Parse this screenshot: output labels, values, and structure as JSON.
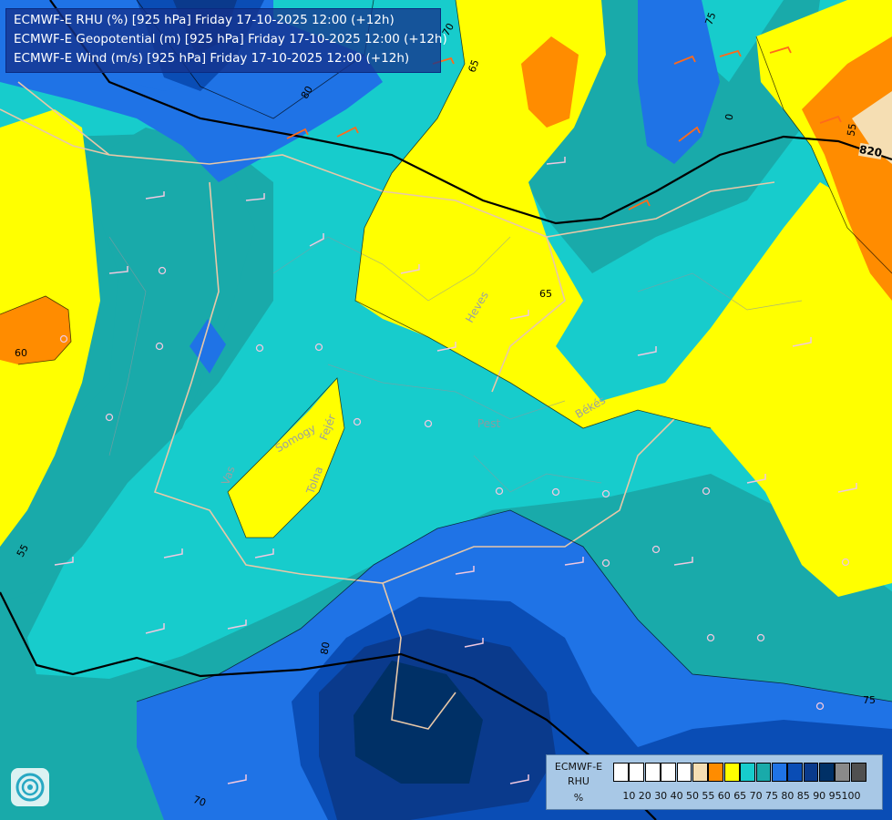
{
  "header": {
    "line1": "ECMWF-E RHU (%) [925 hPa] Friday 17-10-2025 12:00 (+12h)",
    "line2": "ECMWF-E Geopotential (m) [925 hPa] Friday 17-10-2025 12:00 (+12h)",
    "line3": "ECMWF-E Wind (m/s) [925 hPa] Friday 17-10-2025 12:00 (+12h)"
  },
  "legend": {
    "model": "ECMWF-E",
    "param": "RHU",
    "unit": "%",
    "colors": [
      "#ffffff",
      "#ffffff",
      "#ffffff",
      "#ffffff",
      "#ffffff",
      "#f5deb3",
      "#ff8c00",
      "#ffff00",
      "#17cccc",
      "#19aaaa",
      "#1f73e6",
      "#0a4db5",
      "#0a3a8c",
      "#003066",
      "#8a8a8a",
      "#505050"
    ],
    "ticks": [
      "10",
      "20",
      "30",
      "40",
      "50",
      "55",
      "60",
      "65",
      "70",
      "75",
      "80",
      "85",
      "90",
      "95",
      "100"
    ]
  },
  "map": {
    "regions": [
      "Heves",
      "Békés",
      "Pest",
      "Somogy",
      "Fejér",
      "Tolna",
      "Vas"
    ],
    "contour_labels": [
      "70",
      "75",
      "80",
      "65",
      "0",
      "55",
      "820",
      "60",
      "65",
      "55",
      "80",
      "70",
      "75",
      "65"
    ],
    "colors": {
      "c55": "#f5deb3",
      "c60": "#ff8c00",
      "c65": "#ffff00",
      "c70": "#17cccc",
      "c75": "#19aaaa",
      "c80": "#1f73e6",
      "c85": "#0a4db5",
      "c90": "#003066"
    }
  },
  "logo": {
    "name": "ecmwf-logo-icon"
  }
}
